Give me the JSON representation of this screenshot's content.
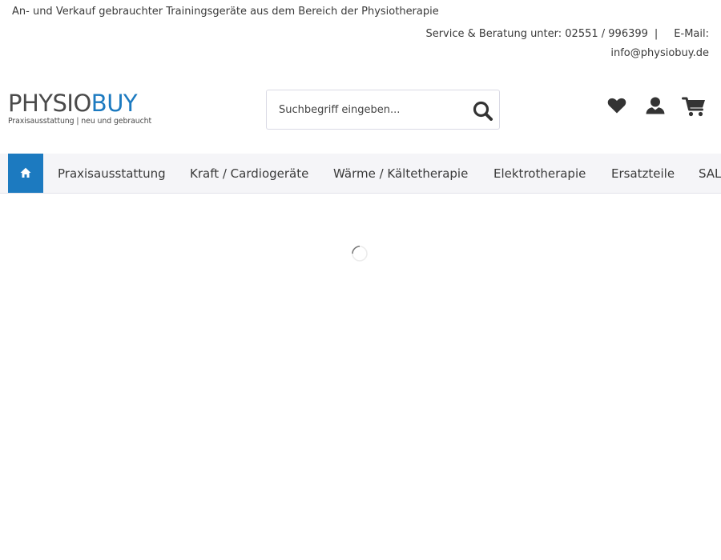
{
  "topbar": {
    "tagline": "An- und Verkauf gebrauchter Trainingsgeräte aus dem Bereich der Physiotherapie",
    "service_text": "Service & Beratung unter: 02551 / 996399",
    "separator": "|",
    "email_label": "E-Mail:",
    "email_address": "info@physiobuy.de"
  },
  "logo": {
    "part1": "PHYSIO",
    "part2": "BUY",
    "tagline": "Praxisausstattung | neu und gebraucht",
    "colors": {
      "gray": "#4a4a4a",
      "blue": "#1c7ac0"
    }
  },
  "search": {
    "placeholder": "Suchbegriff eingeben...",
    "value": "",
    "button_icon": "search-icon"
  },
  "header_icons": {
    "wishlist_icon": "heart-icon",
    "account_icon": "user-icon",
    "cart_icon": "cart-icon"
  },
  "nav": {
    "home_icon": "home-icon",
    "items": [
      {
        "label": "Praxisausstattung"
      },
      {
        "label": "Kraft / Cardiogeräte"
      },
      {
        "label": "Wärme / Kältetherapie"
      },
      {
        "label": "Elektrotherapie"
      },
      {
        "label": "Ersatzteile"
      },
      {
        "label": "SALE"
      }
    ],
    "accent_color": "#1c7ac0"
  },
  "content": {
    "loading_icon": "spinner-icon"
  }
}
